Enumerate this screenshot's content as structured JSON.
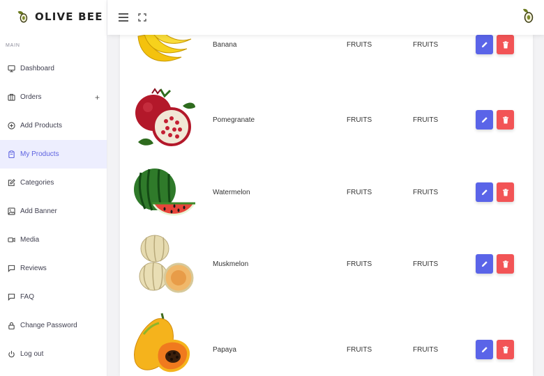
{
  "brand": {
    "name": "OLIVE BEE"
  },
  "sidebar": {
    "section": "MAIN",
    "items": [
      {
        "label": "Dashboard",
        "icon": "monitor-icon"
      },
      {
        "label": "Orders",
        "icon": "briefcase-icon",
        "expand": "+"
      },
      {
        "label": "Add Products",
        "icon": "plus-circle-icon"
      },
      {
        "label": "My Products",
        "icon": "clipboard-icon",
        "active": true
      },
      {
        "label": "Categories",
        "icon": "edit-icon"
      },
      {
        "label": "Add Banner",
        "icon": "image-icon"
      },
      {
        "label": "Media",
        "icon": "video-icon"
      },
      {
        "label": "Reviews",
        "icon": "message-icon"
      },
      {
        "label": "FAQ",
        "icon": "message-icon"
      },
      {
        "label": "Change Password",
        "icon": "lock-icon"
      },
      {
        "label": "Log out",
        "icon": "power-icon"
      }
    ]
  },
  "products": [
    {
      "name": "Banana",
      "category": "FRUITS",
      "subcategory": "FRUITS"
    },
    {
      "name": "Pomegranate",
      "category": "FRUITS",
      "subcategory": "FRUITS"
    },
    {
      "name": "Watermelon",
      "category": "FRUITS",
      "subcategory": "FRUITS"
    },
    {
      "name": "Muskmelon",
      "category": "FRUITS",
      "subcategory": "FRUITS"
    },
    {
      "name": "Papaya",
      "category": "FRUITS",
      "subcategory": "FRUITS"
    }
  ],
  "colors": {
    "accent": "#5a64e8",
    "danger": "#f25456",
    "active_bg": "#edeefe"
  }
}
